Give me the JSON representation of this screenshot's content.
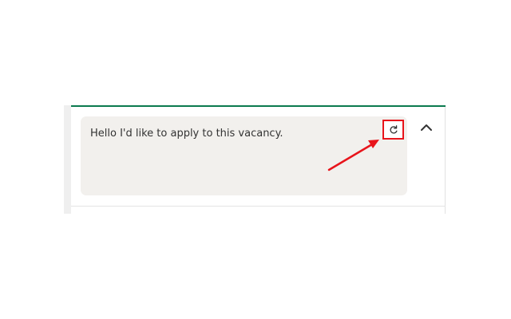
{
  "message": {
    "text": "Hello I'd like to apply to this vacancy."
  },
  "icons": {
    "refresh": "refresh-icon",
    "collapse": "chevron-up-icon",
    "annotation": "red-arrow"
  },
  "colors": {
    "accent": "#0b7a4e",
    "message_background": "#f2f0ed",
    "highlight": "#e8141b"
  }
}
